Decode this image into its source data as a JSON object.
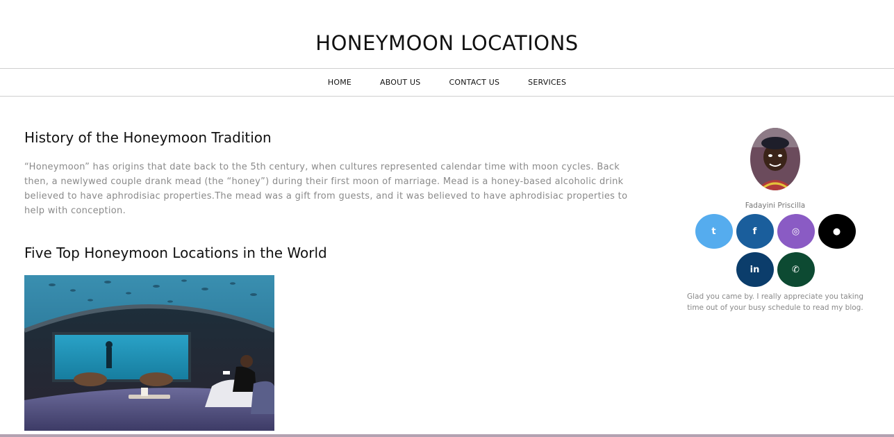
{
  "header": {
    "title": "HONEYMOON LOCATIONS"
  },
  "nav": [
    {
      "label": "HOME"
    },
    {
      "label": "ABOUT US"
    },
    {
      "label": "CONTACT US"
    },
    {
      "label": "SERVICES"
    }
  ],
  "main": {
    "history_title": "History of the Honeymoon Tradition",
    "history_text": "“Honeymoon” has origins that date back to the 5th century, when cultures represented calendar time with moon cycles. Back then, a newlywed couple drank mead (the “honey”) during their first moon of marriage. Mead is a honey-based alcoholic drink believed to have aphrodisiac properties.The mead was a gift from guests, and it was believed to have aphrodisiac properties to help with conception.",
    "top_title": "Five Top Honeymoon Locations in the World"
  },
  "sidebar": {
    "author_name": "Fadayini Priscilla",
    "bio": "Glad you came by. I really appreciate you taking time out of your busy schedule to read my blog.",
    "socials": [
      {
        "icon": "twitter-icon",
        "glyph": "t",
        "color": "#55acee"
      },
      {
        "icon": "facebook-icon",
        "glyph": "f",
        "color": "#1a5e9c"
      },
      {
        "icon": "instagram-icon",
        "glyph": "◎",
        "color": "#8a5bc4"
      },
      {
        "icon": "github-icon",
        "glyph": "●",
        "color": "#000000"
      },
      {
        "icon": "linkedin-icon",
        "glyph": "in",
        "color": "#0b3d6b"
      },
      {
        "icon": "whatsapp-icon",
        "glyph": "✆",
        "color": "#0d4a32"
      }
    ]
  },
  "colors": {
    "text": "#111111",
    "muted_text": "#8a8a8a",
    "divider": "#cfcfcf",
    "bottom_bar": "#b3a2b1"
  }
}
